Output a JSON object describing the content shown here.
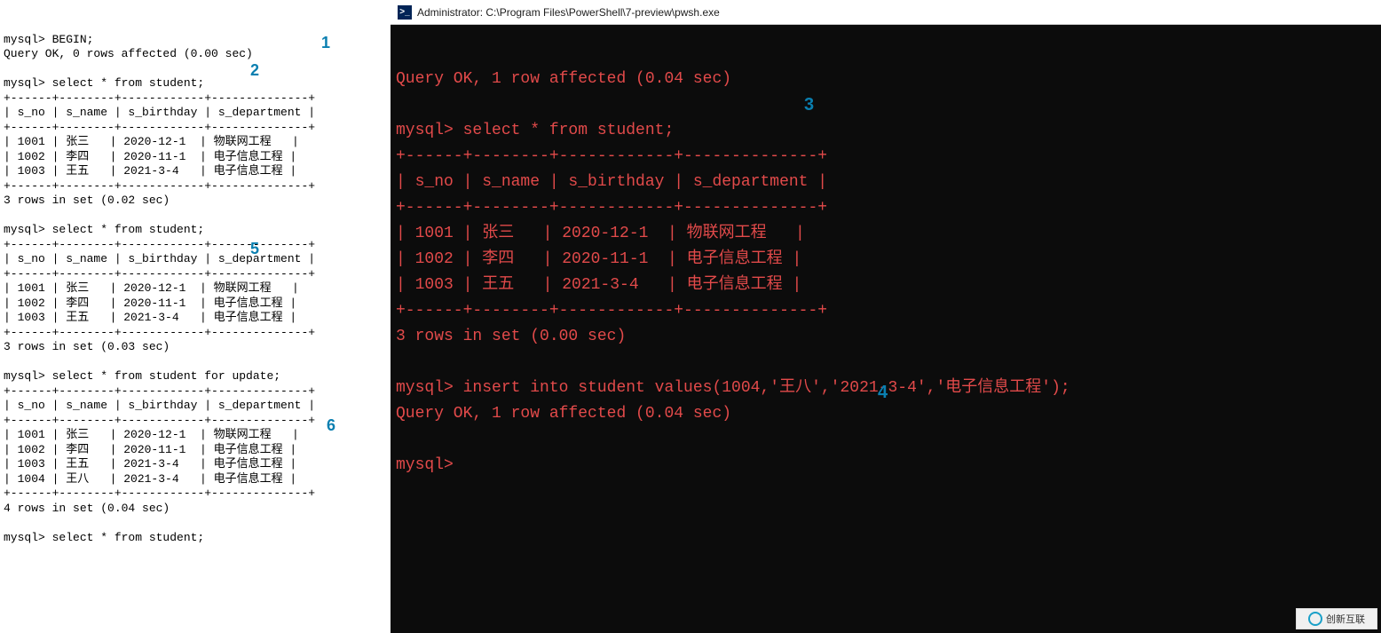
{
  "titlebar": {
    "text": "Administrator: C:\\Program Files\\PowerShell\\7-preview\\pwsh.exe"
  },
  "markers": {
    "m1": "1",
    "m2": "2",
    "m3": "3",
    "m4": "4",
    "m5": "5",
    "m6": "6"
  },
  "left": {
    "l01": "mysql> BEGIN;",
    "l02": "Query OK, 0 rows affected (0.00 sec)",
    "l03": "",
    "l04": "mysql> select * from student;",
    "l05": "+------+--------+------------+--------------+",
    "l06": "| s_no | s_name | s_birthday | s_department |",
    "l07": "+------+--------+------------+--------------+",
    "l08": "| 1001 | 张三   | 2020-12-1  | 物联网工程   |",
    "l09": "| 1002 | 李四   | 2020-11-1  | 电子信息工程 |",
    "l10": "| 1003 | 王五   | 2021-3-4   | 电子信息工程 |",
    "l11": "+------+--------+------------+--------------+",
    "l12": "3 rows in set (0.02 sec)",
    "l13": "",
    "l14": "mysql> select * from student;",
    "l15": "+------+--------+------------+--------------+",
    "l16": "| s_no | s_name | s_birthday | s_department |",
    "l17": "+------+--------+------------+--------------+",
    "l18": "| 1001 | 张三   | 2020-12-1  | 物联网工程   |",
    "l19": "| 1002 | 李四   | 2020-11-1  | 电子信息工程 |",
    "l20": "| 1003 | 王五   | 2021-3-4   | 电子信息工程 |",
    "l21": "+------+--------+------------+--------------+",
    "l22": "3 rows in set (0.03 sec)",
    "l23": "",
    "l24": "mysql> select * from student for update;",
    "l25": "+------+--------+------------+--------------+",
    "l26": "| s_no | s_name | s_birthday | s_department |",
    "l27": "+------+--------+------------+--------------+",
    "l28": "| 1001 | 张三   | 2020-12-1  | 物联网工程   |",
    "l29": "| 1002 | 李四   | 2020-11-1  | 电子信息工程 |",
    "l30": "| 1003 | 王五   | 2021-3-4   | 电子信息工程 |",
    "l31": "| 1004 | 王八   | 2021-3-4   | 电子信息工程 |",
    "l32": "+------+--------+------------+--------------+",
    "l33": "4 rows in set (0.04 sec)",
    "l34": "",
    "l35": "mysql> select * from student;"
  },
  "right": {
    "r01": "Query OK, 1 row affected (0.04 sec)",
    "r02": "",
    "r03": "mysql> select * from student;",
    "r04": "+------+--------+------------+--------------+",
    "r05": "| s_no | s_name | s_birthday | s_department |",
    "r06": "+------+--------+------------+--------------+",
    "r07": "| 1001 | 张三   | 2020-12-1  | 物联网工程   |",
    "r08": "| 1002 | 李四   | 2020-11-1  | 电子信息工程 |",
    "r09": "| 1003 | 王五   | 2021-3-4   | 电子信息工程 |",
    "r10": "+------+--------+------------+--------------+",
    "r11": "3 rows in set (0.00 sec)",
    "r12": "",
    "r13": "mysql> insert into student values(1004,'王八','2021-3-4','电子信息工程');",
    "r14": "Query OK, 1 row affected (0.04 sec)",
    "r15": "",
    "r16": "mysql>"
  },
  "watermark": {
    "text": "创新互联"
  }
}
